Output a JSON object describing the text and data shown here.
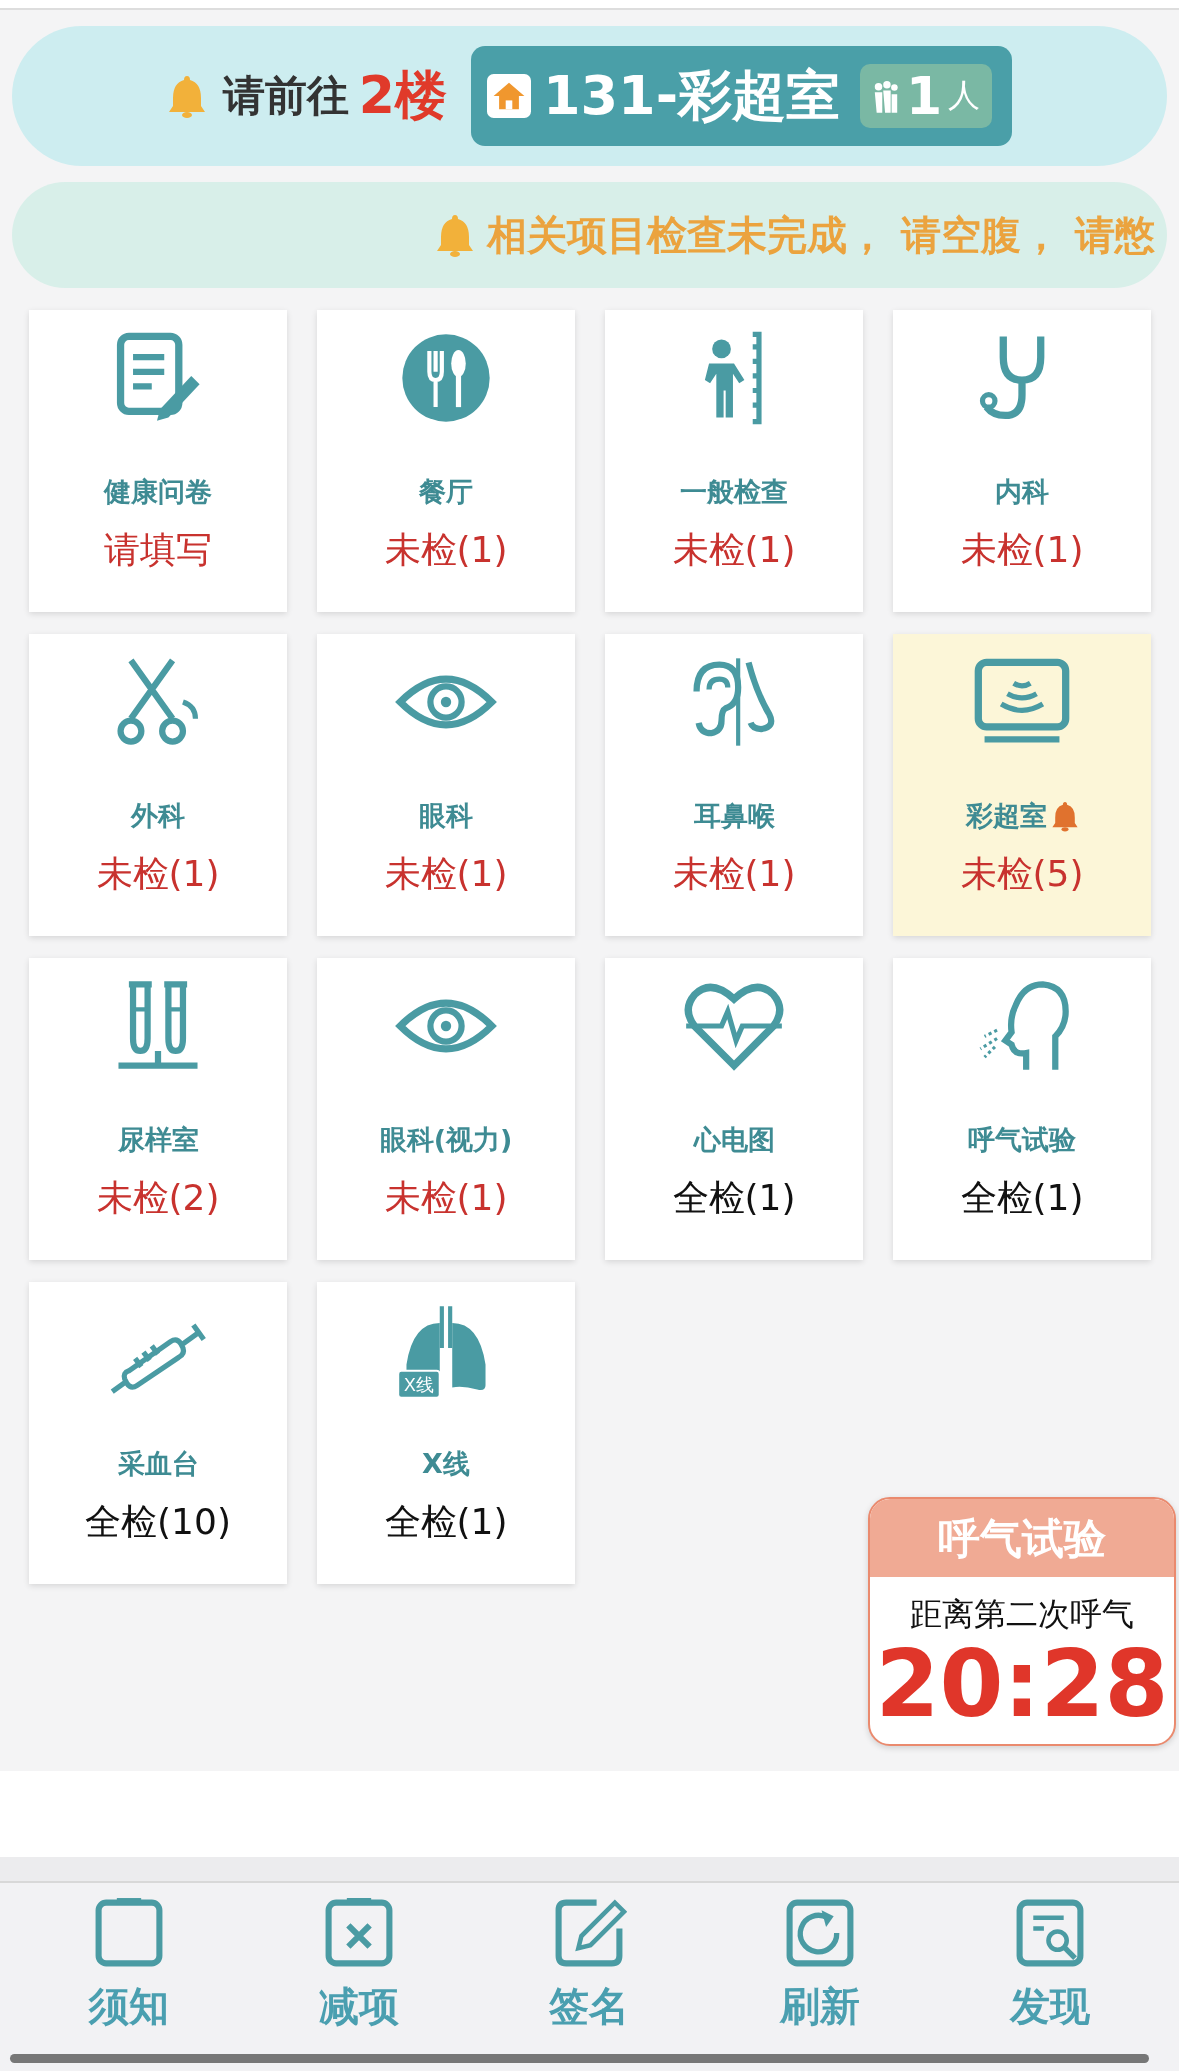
{
  "banner": {
    "prefix": "请前往",
    "floor": "2楼",
    "room": "131-彩超室",
    "queue_count": "1",
    "queue_unit": "人"
  },
  "notice": "相关项目检查未完成， 请空腹， 请憋",
  "tiles": [
    {
      "name": "健康问卷",
      "status": "请填写",
      "done": false,
      "selected": false,
      "alert": false
    },
    {
      "name": "餐厅",
      "status": "未检(1)",
      "done": false,
      "selected": false,
      "alert": false
    },
    {
      "name": "一般检查",
      "status": "未检(1)",
      "done": false,
      "selected": false,
      "alert": false
    },
    {
      "name": "内科",
      "status": "未检(1)",
      "done": false,
      "selected": false,
      "alert": false
    },
    {
      "name": "外科",
      "status": "未检(1)",
      "done": false,
      "selected": false,
      "alert": false
    },
    {
      "name": "眼科",
      "status": "未检(1)",
      "done": false,
      "selected": false,
      "alert": false
    },
    {
      "name": "耳鼻喉",
      "status": "未检(1)",
      "done": false,
      "selected": false,
      "alert": false
    },
    {
      "name": "彩超室",
      "status": "未检(5)",
      "done": false,
      "selected": true,
      "alert": true
    },
    {
      "name": "尿样室",
      "status": "未检(2)",
      "done": false,
      "selected": false,
      "alert": false
    },
    {
      "name": "眼科(视力)",
      "status": "未检(1)",
      "done": false,
      "selected": false,
      "alert": false
    },
    {
      "name": "心电图",
      "status": "全检(1)",
      "done": true,
      "selected": false,
      "alert": false
    },
    {
      "name": "呼气试验",
      "status": "全检(1)",
      "done": true,
      "selected": false,
      "alert": false
    },
    {
      "name": "采血台",
      "status": "全检(10)",
      "done": true,
      "selected": false,
      "alert": false
    },
    {
      "name": "X线",
      "status": "全检(1)",
      "done": true,
      "selected": false,
      "alert": false,
      "icon_label": "X线"
    }
  ],
  "timer": {
    "title": "呼气试验",
    "label": "距离第二次呼气",
    "time": "20:28"
  },
  "nav": [
    {
      "label": "须知"
    },
    {
      "label": "减项"
    },
    {
      "label": "签名"
    },
    {
      "label": "刷新"
    },
    {
      "label": "发现"
    }
  ]
}
